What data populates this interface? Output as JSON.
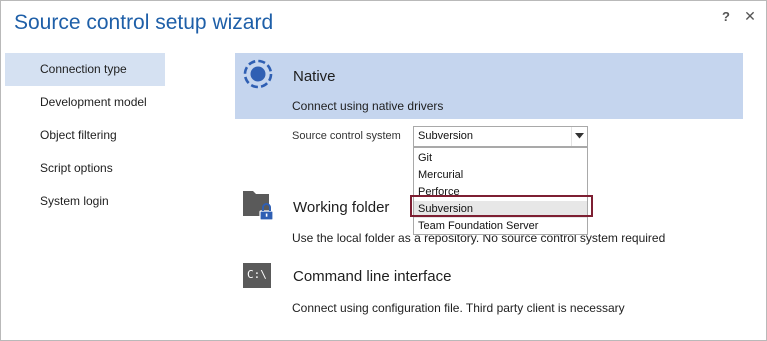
{
  "window": {
    "title": "Source control setup wizard",
    "help_glyph": "?",
    "close_glyph": "✕"
  },
  "nav": {
    "items": [
      {
        "label": "Connection type",
        "active": true
      },
      {
        "label": "Development model",
        "active": false
      },
      {
        "label": "Object filtering",
        "active": false
      },
      {
        "label": "Script options",
        "active": false
      },
      {
        "label": "System login",
        "active": false
      }
    ]
  },
  "options": {
    "native": {
      "title": "Native",
      "description": "Connect using native drivers",
      "icon": "radio-selected-icon"
    },
    "working_folder": {
      "title": "Working folder",
      "description": "Use the local folder as a repository. No source control system required",
      "icon": "locked-folder-icon"
    },
    "command_line": {
      "title": "Command line interface",
      "description": "Connect using configuration file. Third party client is necessary",
      "icon": "command-prompt-icon",
      "icon_text": "C:\\"
    }
  },
  "source_control": {
    "label": "Source control system",
    "selected": "Subversion",
    "options": [
      "Git",
      "Mercurial",
      "Perforce",
      "Subversion",
      "Team Foundation Server"
    ],
    "highlighted_option": "Subversion"
  },
  "colors": {
    "title": "#1e5fa8",
    "selected_panel": "#c5d5ee",
    "active_nav": "#d5e1f2",
    "highlight_border": "#7d1f32",
    "icon_blue": "#2f5fb3",
    "icon_gray": "#5a5a5a"
  }
}
